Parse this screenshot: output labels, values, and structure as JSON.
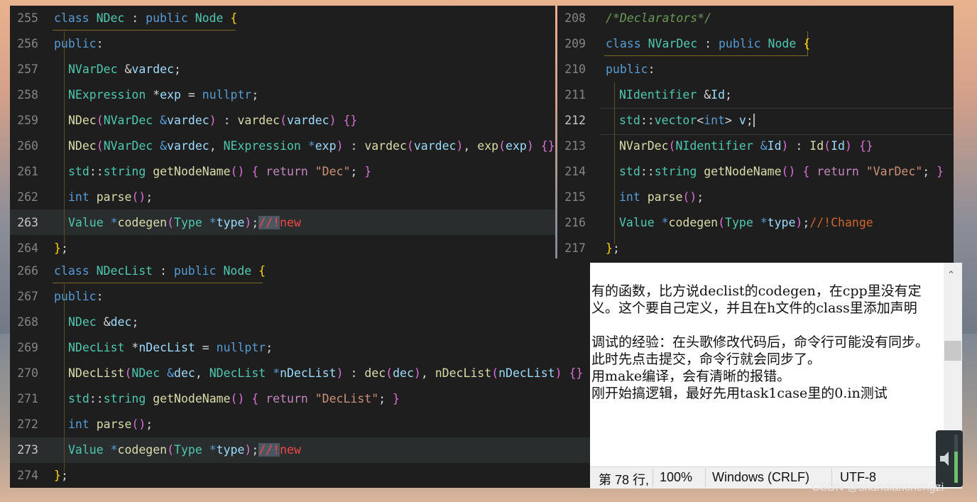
{
  "left_top_editor": {
    "lines": [
      {
        "no": "255"
      },
      {
        "no": "256"
      },
      {
        "no": "257"
      },
      {
        "no": "258"
      },
      {
        "no": "259"
      },
      {
        "no": "260"
      },
      {
        "no": "261"
      },
      {
        "no": "262"
      },
      {
        "no": "263"
      },
      {
        "no": "264"
      }
    ]
  },
  "left_bottom_editor": {
    "lines": [
      {
        "no": "266"
      },
      {
        "no": "267"
      },
      {
        "no": "268"
      },
      {
        "no": "269"
      },
      {
        "no": "270"
      },
      {
        "no": "271"
      },
      {
        "no": "272"
      },
      {
        "no": "273"
      },
      {
        "no": "274"
      }
    ]
  },
  "right_editor": {
    "lines": [
      {
        "no": "208"
      },
      {
        "no": "209"
      },
      {
        "no": "210"
      },
      {
        "no": "211"
      },
      {
        "no": "212"
      },
      {
        "no": "213"
      },
      {
        "no": "214"
      },
      {
        "no": "215"
      },
      {
        "no": "216"
      },
      {
        "no": "217"
      }
    ]
  },
  "notepad": {
    "text": "有的函数，比方说declist的codegen，在cpp里没有定义。这个要自己定义，并且在h文件的class里添加声明\n\n调试的经验：在头歌修改代码后，命令行可能没有同步。此时先点击提交，命令行就会同步了。\n用make编译，会有清晰的报错。\n刚开始搞逻辑，最好先用task1case里的0.in测试",
    "status": {
      "position": "第 78 行,",
      "zoom": "100%",
      "line_ending": "Windows (CRLF)",
      "encoding": "UTF-8"
    }
  },
  "watermark": "CSDN @shandianchengzi"
}
